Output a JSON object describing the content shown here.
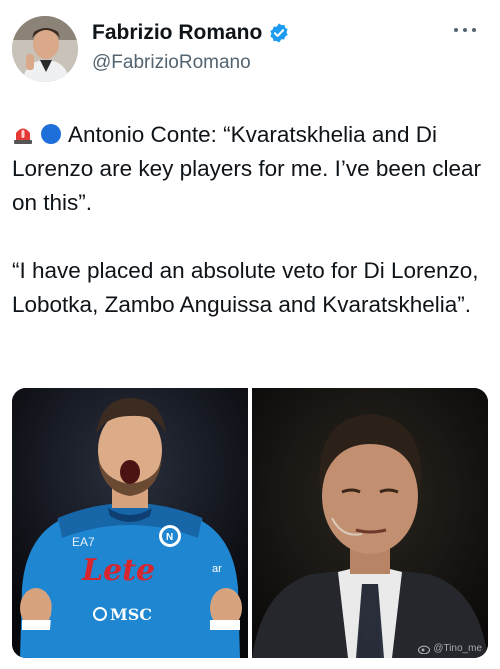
{
  "author": {
    "display_name": "Fabrizio Romano",
    "handle": "@FabrizioRomano",
    "verified": true,
    "avatar_icon": "profile-photo",
    "more_icon": "more-horizontal-icon"
  },
  "tweet": {
    "emojis": [
      "siren-emoji",
      "blue-circle-emoji"
    ],
    "paragraph1": "Antonio Conte: “Kvaratskhelia and Di Lorenzo are key players for me. I’ve been clear on this”.",
    "paragraph2": "“I have placed an absolute veto for Di Lorenzo, Lobotka, Zambo Anguissa and Kvaratskhelia”."
  },
  "media": {
    "left_photo": {
      "kit_brand": "EA7",
      "sponsor": "Lete",
      "sponsor_secondary": "MSC",
      "sleeve_text": "ar"
    },
    "right_photo": {}
  },
  "watermark": "@Tino_me",
  "colors": {
    "verified_blue": "#1d9bf0",
    "text_primary": "#0f1419",
    "text_secondary": "#536471",
    "kit_blue": "#1f86d1",
    "lete_red": "#d8262e"
  }
}
